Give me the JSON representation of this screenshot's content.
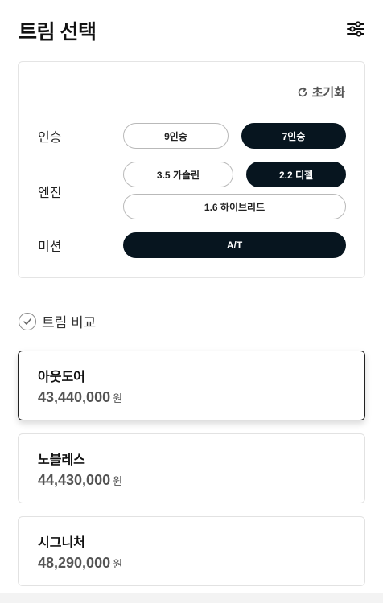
{
  "header": {
    "title": "트림 선택",
    "filter_icon": "sliders-icon"
  },
  "options": {
    "reset_label": "초기화",
    "rows": {
      "seats": {
        "label": "인승",
        "choices": [
          {
            "label": "9인승",
            "selected": false
          },
          {
            "label": "7인승",
            "selected": true
          }
        ]
      },
      "engine": {
        "label": "엔진",
        "choices": [
          {
            "label": "3.5 가솔린",
            "selected": false
          },
          {
            "label": "2.2 디젤",
            "selected": true
          },
          {
            "label": "1.6 하이브리드",
            "selected": false
          }
        ]
      },
      "transmission": {
        "label": "미션",
        "choices": [
          {
            "label": "A/T",
            "selected": true
          }
        ]
      }
    }
  },
  "compare": {
    "label": "트림 비교"
  },
  "trims": [
    {
      "name": "아웃도어",
      "price": "43,440,000",
      "unit": "원",
      "selected": true
    },
    {
      "name": "노블레스",
      "price": "44,430,000",
      "unit": "원",
      "selected": false
    },
    {
      "name": "시그니처",
      "price": "48,290,000",
      "unit": "원",
      "selected": false
    }
  ],
  "colors": {
    "active_chip": "#07151f",
    "card_border": "#e2e2e2",
    "price_text": "#555555"
  }
}
